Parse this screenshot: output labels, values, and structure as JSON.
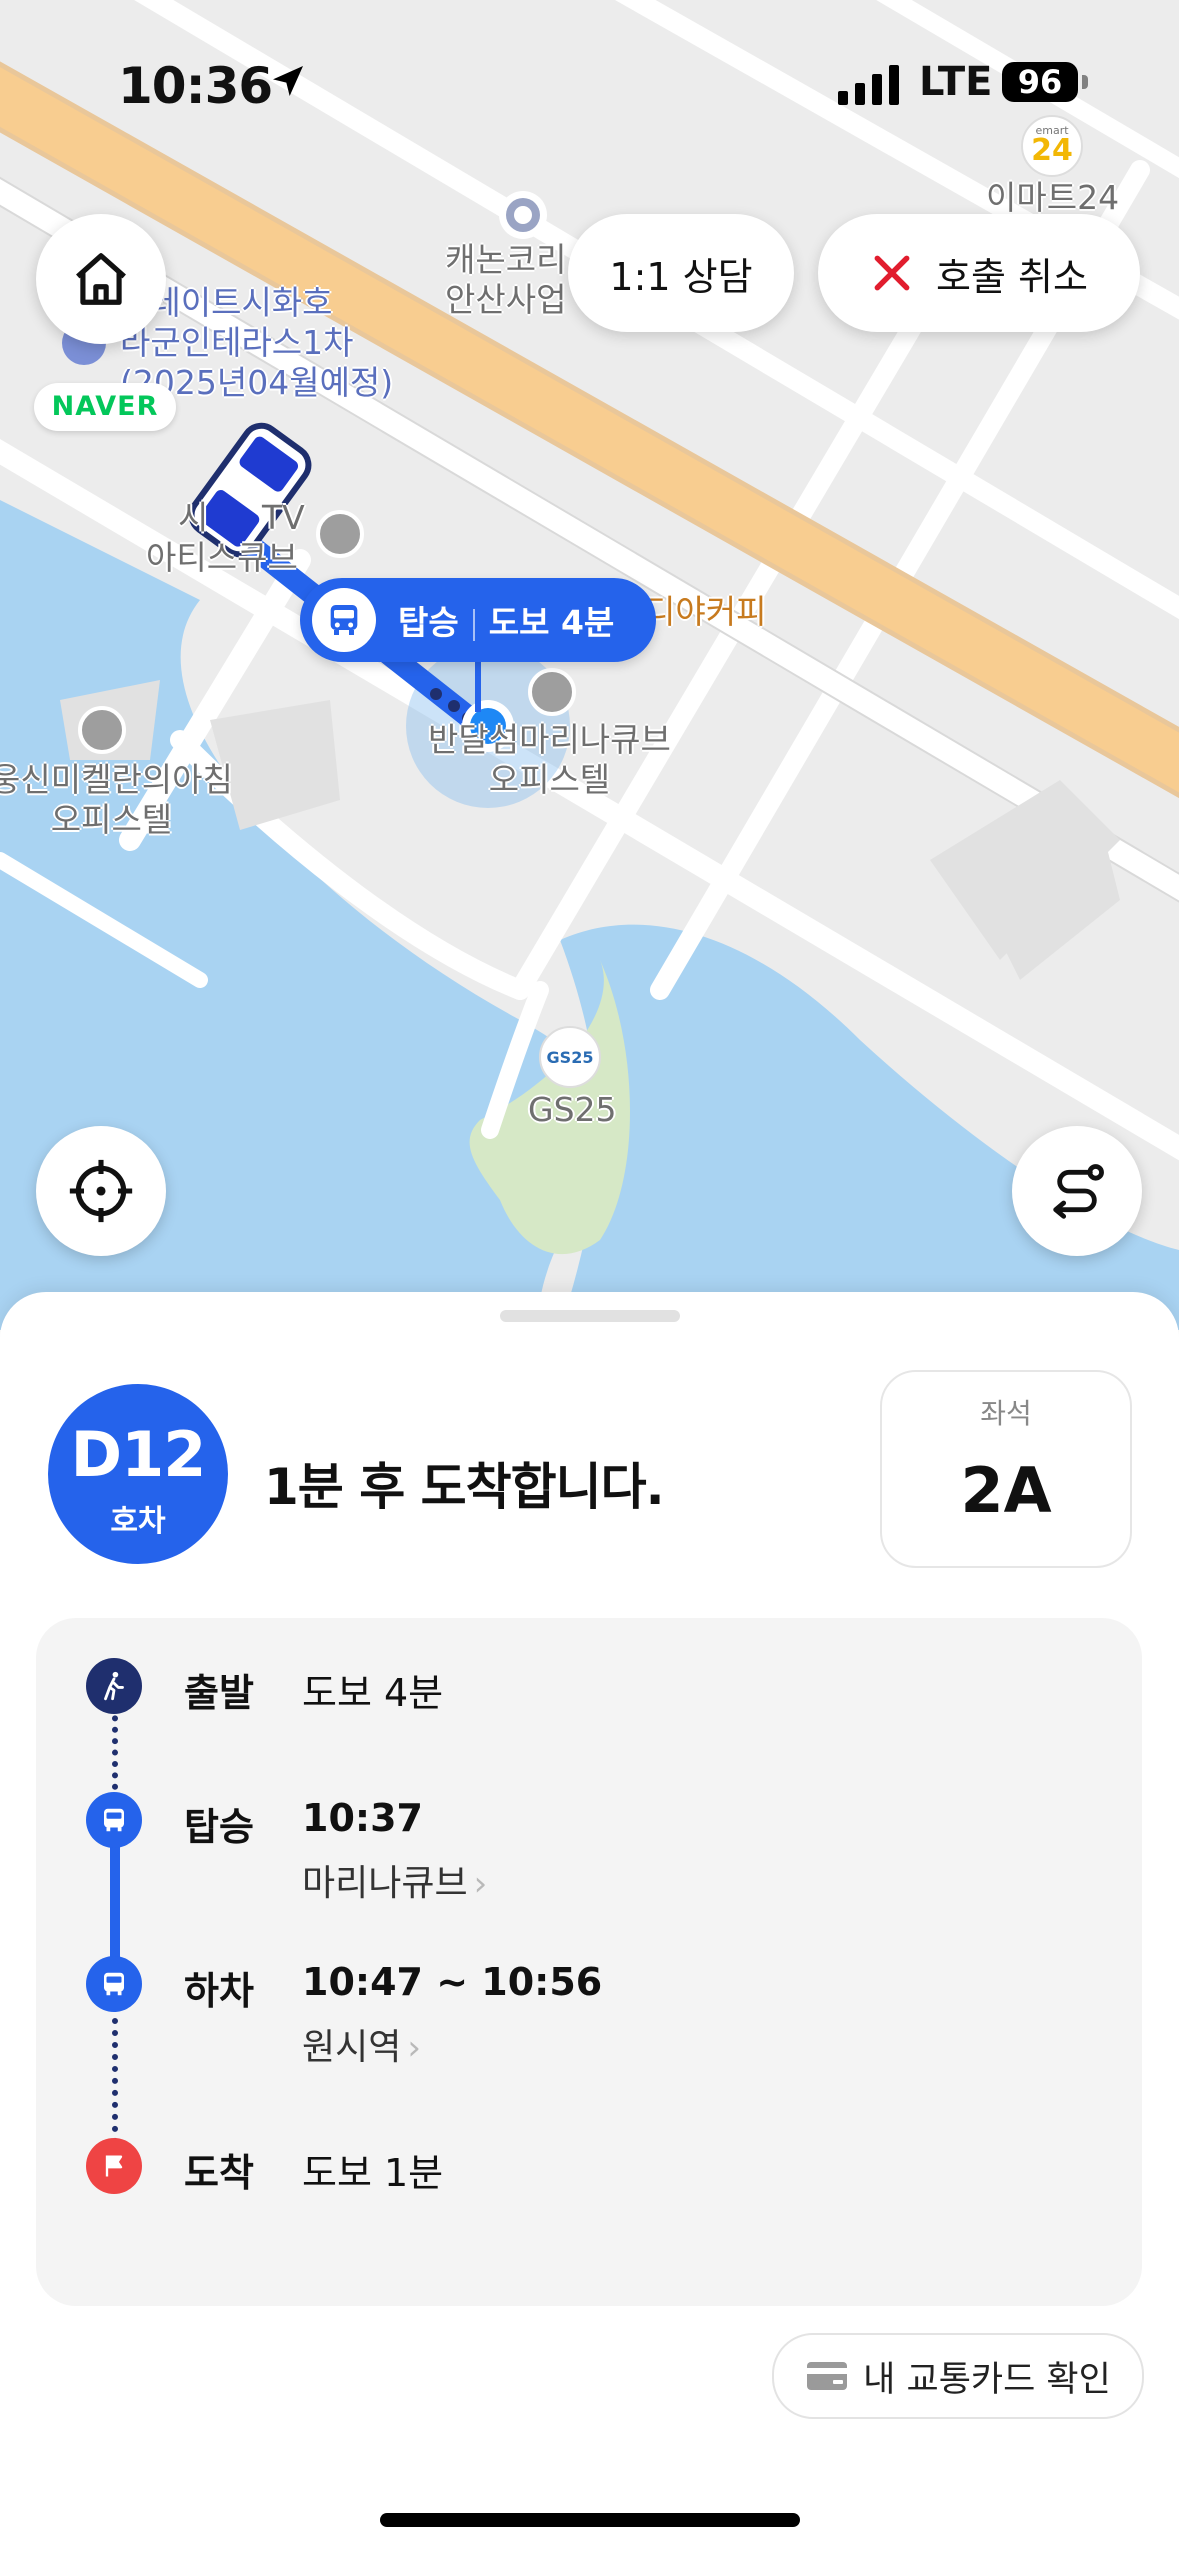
{
  "status_bar": {
    "time": "10:36",
    "network": "LTE",
    "battery": "96"
  },
  "map": {
    "brand_badge": "NAVER",
    "labels": {
      "emart24_logo": "emart",
      "emart24_num": "24",
      "emart24": "이마트24",
      "canon": "캐논코리",
      "canon2": "안산사업",
      "estate1": "스테이트시화호",
      "estate2": "라군인테라스1차",
      "estate3": "(2025년04월예정)",
      "arte1": "시",
      "arte1b": "TV",
      "arte2": "아티스큐브",
      "cafe": "디야커피",
      "marina1": "반달섬마리나큐브",
      "marina2": "오피스텔",
      "michelan1": "웅신미켈란의아침",
      "michelan2": "오피스텔",
      "gs25_logo": "GS25",
      "gs25": "GS25"
    },
    "boarding_bubble": {
      "action": "탑승",
      "walk": "도보 4분"
    }
  },
  "top_buttons": {
    "consult": "1:1 상담",
    "cancel": "호출 취소"
  },
  "bus": {
    "number": "D12",
    "unit": "호차"
  },
  "arrival_message": "1분 후 도착합니다.",
  "seat": {
    "label": "좌석",
    "value": "2A"
  },
  "route": {
    "depart": {
      "label": "출발",
      "value": "도보 4분"
    },
    "board": {
      "label": "탑승",
      "time": "10:37",
      "stop": "마리나큐브"
    },
    "alight": {
      "label": "하차",
      "time": "10:47 ~ 10:56",
      "stop": "원시역"
    },
    "arrive": {
      "label": "도착",
      "value": "도보 1분"
    }
  },
  "transit_card_button": "내 교통카드 확인",
  "colors": {
    "accent": "#2563eb",
    "navy": "#1f2f6e",
    "flag": "#ef4444",
    "road": "#f7c98b",
    "water": "#a9d3f2"
  }
}
